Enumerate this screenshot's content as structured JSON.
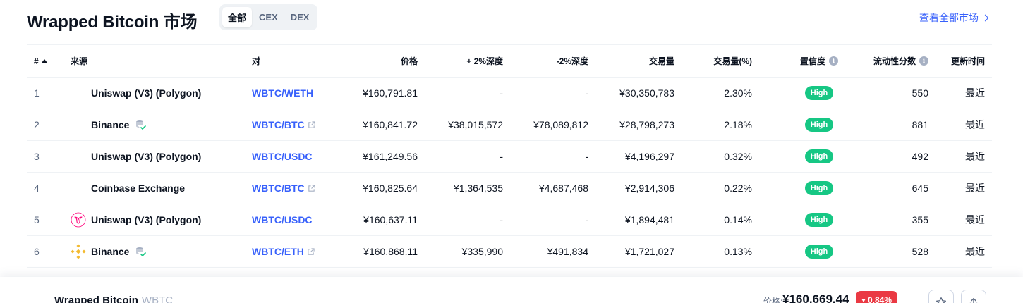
{
  "header": {
    "title": "Wrapped Bitcoin 市场",
    "filters": [
      "全部",
      "CEX",
      "DEX"
    ],
    "active_filter": "全部",
    "view_all": "查看全部市场"
  },
  "table": {
    "columns": {
      "idx": "#",
      "source": "来源",
      "pair": "对",
      "price": "价格",
      "plus_depth": "+ 2%深度",
      "minus_depth": "-2%深度",
      "volume": "交易量",
      "volume_pct": "交易量(%)",
      "confidence": "置信度",
      "liquidity": "流动性分数",
      "updated": "更新时间"
    },
    "rows": [
      {
        "idx": "1",
        "source": "Uniswap (V3) (Polygon)",
        "logo": "none",
        "cex": false,
        "pair": "WBTC/WETH",
        "external": false,
        "price": "¥160,791.81",
        "plus_depth": "-",
        "minus_depth": "-",
        "volume": "¥30,350,783",
        "volume_pct": "2.30%",
        "confidence": "High",
        "liquidity": "550",
        "updated": "最近"
      },
      {
        "idx": "2",
        "source": "Binance",
        "logo": "none",
        "cex": true,
        "pair": "WBTC/BTC",
        "external": true,
        "price": "¥160,841.72",
        "plus_depth": "¥38,015,572",
        "minus_depth": "¥78,089,812",
        "volume": "¥28,798,273",
        "volume_pct": "2.18%",
        "confidence": "High",
        "liquidity": "881",
        "updated": "最近"
      },
      {
        "idx": "3",
        "source": "Uniswap (V3) (Polygon)",
        "logo": "none",
        "cex": false,
        "pair": "WBTC/USDC",
        "external": false,
        "price": "¥161,249.56",
        "plus_depth": "-",
        "minus_depth": "-",
        "volume": "¥4,196,297",
        "volume_pct": "0.32%",
        "confidence": "High",
        "liquidity": "492",
        "updated": "最近"
      },
      {
        "idx": "4",
        "source": "Coinbase Exchange",
        "logo": "none",
        "cex": false,
        "pair": "WBTC/BTC",
        "external": true,
        "price": "¥160,825.64",
        "plus_depth": "¥1,364,535",
        "minus_depth": "¥4,687,468",
        "volume": "¥2,914,306",
        "volume_pct": "0.22%",
        "confidence": "High",
        "liquidity": "645",
        "updated": "最近"
      },
      {
        "idx": "5",
        "source": "Uniswap (V3) (Polygon)",
        "logo": "uniswap-logo",
        "cex": false,
        "pair": "WBTC/USDC",
        "external": false,
        "price": "¥160,637.11",
        "plus_depth": "-",
        "minus_depth": "-",
        "volume": "¥1,894,481",
        "volume_pct": "0.14%",
        "confidence": "High",
        "liquidity": "355",
        "updated": "最近"
      },
      {
        "idx": "6",
        "source": "Binance",
        "logo": "binance-logo",
        "cex": true,
        "pair": "WBTC/ETH",
        "external": true,
        "price": "¥160,868.11",
        "plus_depth": "¥335,990",
        "minus_depth": "¥491,834",
        "volume": "¥1,721,027",
        "volume_pct": "0.13%",
        "confidence": "High",
        "liquidity": "528",
        "updated": "最近"
      }
    ]
  },
  "bottom_bar": {
    "name": "Wrapped Bitcoin",
    "symbol": "WBTC",
    "price_label": "价格:",
    "price": "¥160,669.44",
    "change": "0.84%",
    "buttons": [
      "star-icon",
      "share-icon"
    ]
  },
  "colors": {
    "accent": "#3861fb",
    "high_badge": "#16c784",
    "negative": "#ea3943",
    "binance": "#f3ba2f",
    "uniswap": "#ff007a"
  }
}
